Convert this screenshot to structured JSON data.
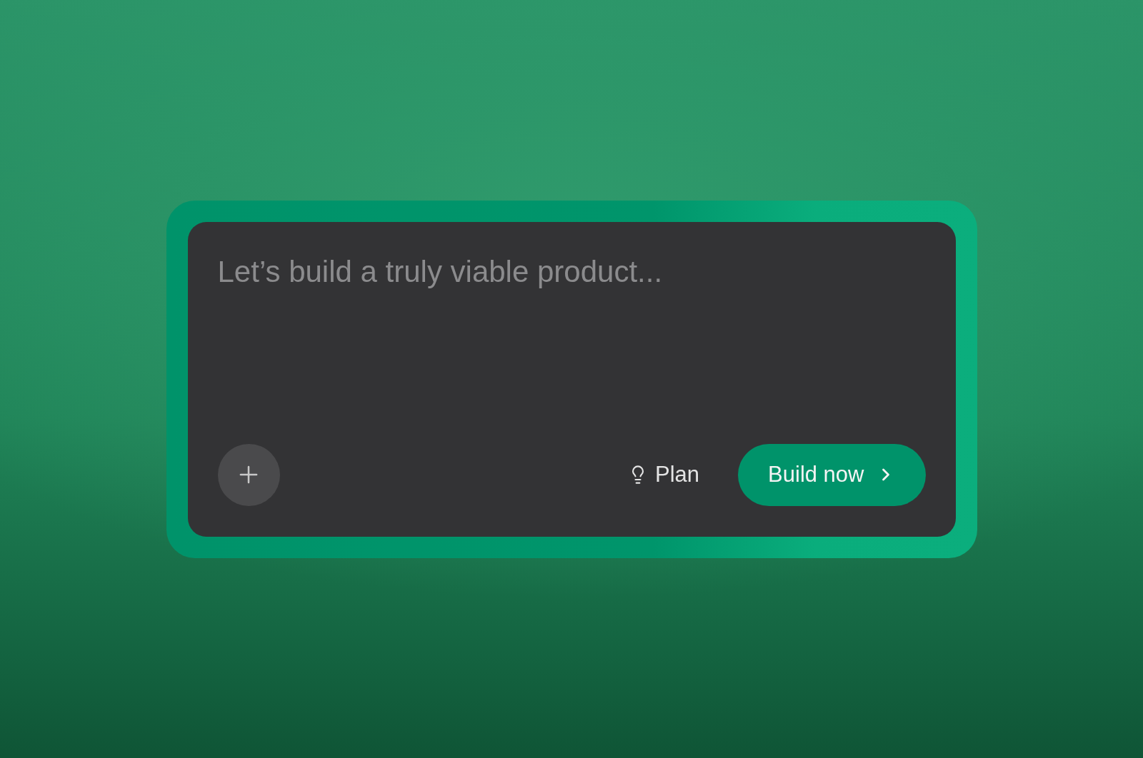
{
  "prompt": {
    "placeholder": "Let’s build a truly viable product..."
  },
  "plan_button": {
    "label": "Plan"
  },
  "build_button": {
    "label": "Build now"
  }
}
